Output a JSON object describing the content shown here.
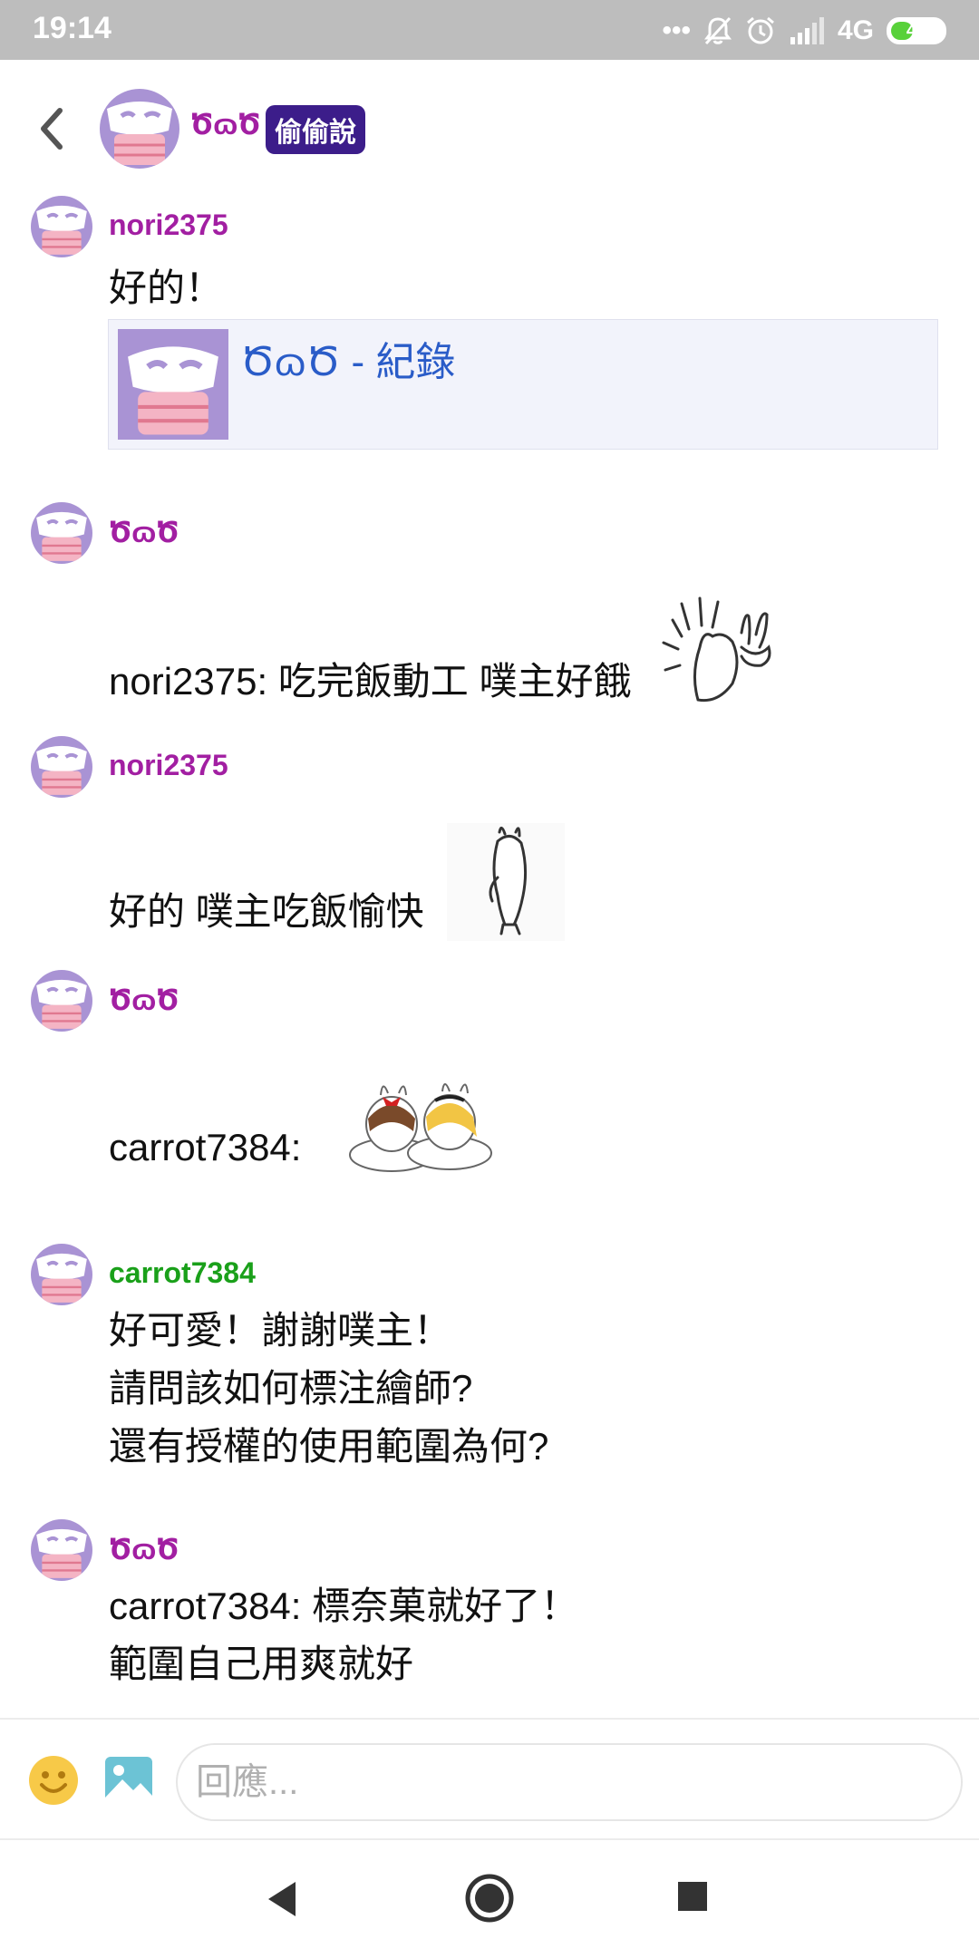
{
  "status_bar": {
    "time": "19:14",
    "network": "4G",
    "battery": "40",
    "battery_level": 0.4,
    "icons": [
      "more-dots-icon",
      "bell-off-icon",
      "alarm-icon",
      "signal-icon",
      "battery-icon"
    ]
  },
  "header": {
    "name": "ԾɷԾ",
    "badge": "偷偷說",
    "back_icon": "back-arrow-icon"
  },
  "colors": {
    "name_purple": "#a21fa2",
    "name_green": "#1aa01a",
    "badge_bg": "#3c1d8a",
    "link_blue": "#2a5cc8",
    "avatar_purple": "#a993d4",
    "avatar_pink": "#f4b4c4"
  },
  "messages": [
    {
      "name": "nori2375",
      "lines": [
        "好的！"
      ],
      "link_card": {
        "title": "ԾɷԾ - 紀錄"
      }
    },
    {
      "name": "ԾɷԾ",
      "lines": [
        "nori2375: 吃完飯動工 噗主好餓"
      ],
      "sticker": "rabbit-wave-sticker"
    },
    {
      "name": "nori2375",
      "lines": [
        "好的 噗主吃飯愉快"
      ],
      "sticker": "rabbit-walk-sticker"
    },
    {
      "name": "ԾɷԾ",
      "lines": [
        "carrot7384:"
      ],
      "sticker": "two-bunnies-sticker"
    },
    {
      "name": "carrot7384",
      "lines": [
        "好可愛！謝謝噗主！",
        "請問該如何標注繪師?",
        "還有授權的使用範圍為何?"
      ]
    },
    {
      "name": "ԾɷԾ",
      "lines": [
        "carrot7384: 標奈菓就好了！",
        "範圍自己用爽就好"
      ]
    }
  ],
  "composer": {
    "placeholder": "回應..."
  },
  "nav": {
    "icons": [
      "nav-back-icon",
      "nav-home-icon",
      "nav-recent-icon"
    ]
  }
}
